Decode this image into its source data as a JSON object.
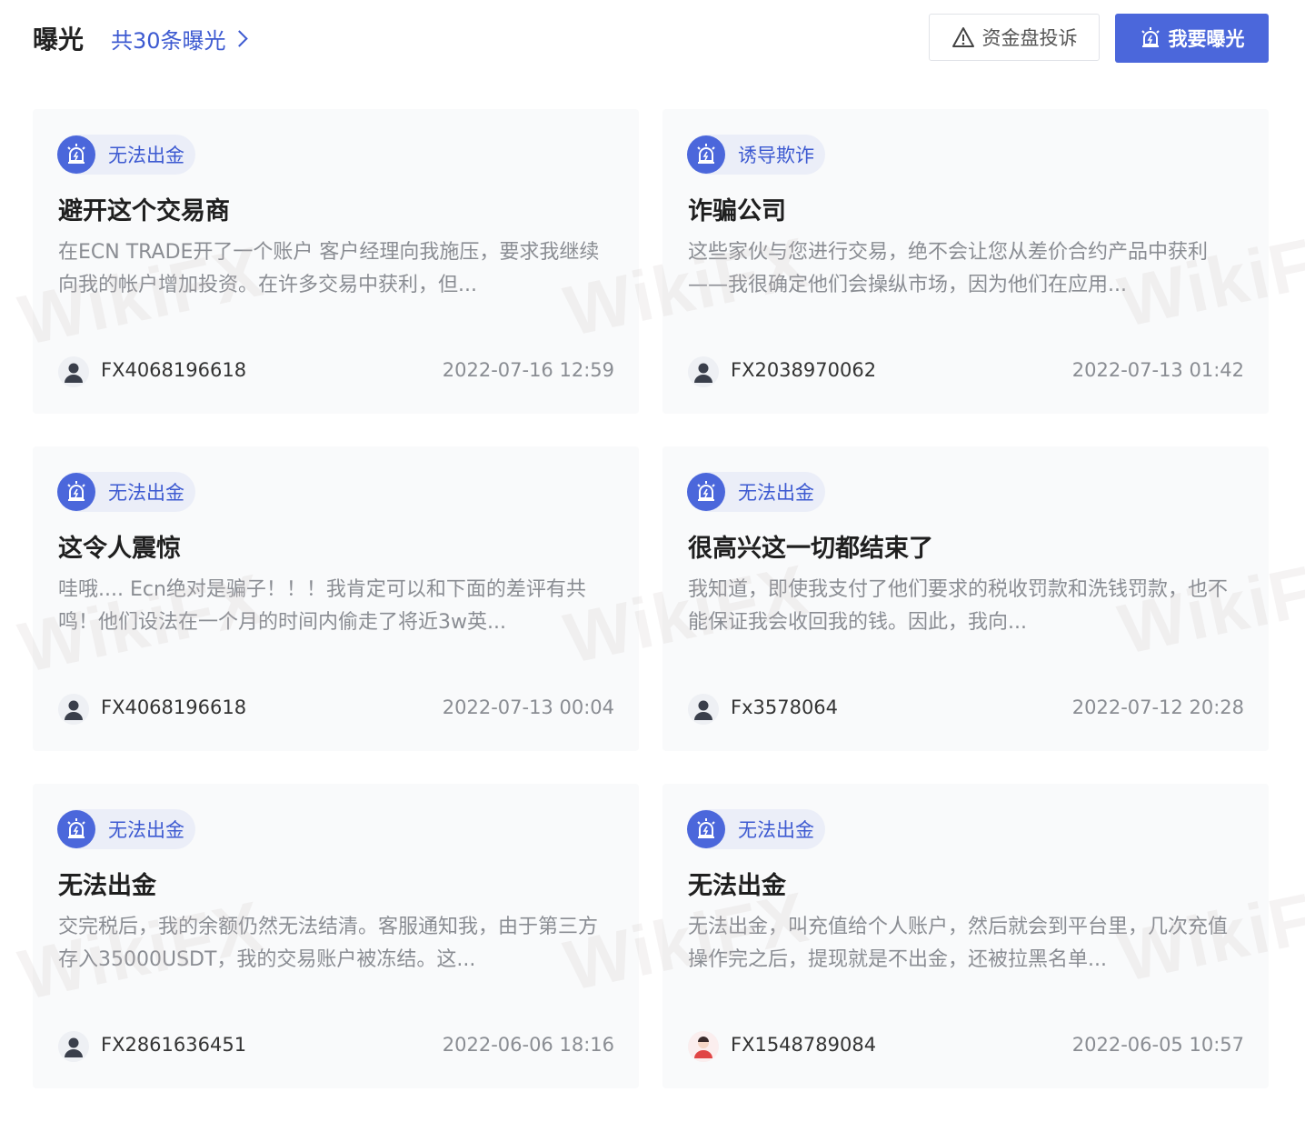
{
  "header": {
    "title": "曝光",
    "count_link": "共30条曝光",
    "complaint_button": "资金盘投诉",
    "expose_button": "我要曝光"
  },
  "watermark": "WikiFX",
  "cards": [
    {
      "tag": "无法出金",
      "title": "避开这个交易商",
      "desc": "在ECN TRADE开了一个账户 客户经理向我施压，要求我继续向我的帐户增加投资。在许多交易中获利，但...",
      "user": "FX4068196618",
      "date": "2022-07-16 12:59",
      "avatar": "default-avatar"
    },
    {
      "tag": "诱导欺诈",
      "title": "诈骗公司",
      "desc": "这些家伙与您进行交易，绝不会让您从差价合约产品中获利——我很确定他们会操纵市场，因为他们在应用...",
      "user": "FX2038970062",
      "date": "2022-07-13 01:42",
      "avatar": "default-avatar"
    },
    {
      "tag": "无法出金",
      "title": "这令人震惊",
      "desc": "哇哦.... Ecn绝对是骗子！！！我肯定可以和下面的差评有共鸣！他们设法在一个月的时间内偷走了将近3w英...",
      "user": "FX4068196618",
      "date": "2022-07-13 00:04",
      "avatar": "default-avatar"
    },
    {
      "tag": "无法出金",
      "title": "很高兴这一切都结束了",
      "desc": "我知道，即使我支付了他们要求的税收罚款和洗钱罚款，也不能保证我会收回我的钱。因此，我向...",
      "user": "Fx3578064",
      "date": "2022-07-12 20:28",
      "avatar": "default-avatar"
    },
    {
      "tag": "无法出金",
      "title": "无法出金",
      "desc": "交完税后，我的余额仍然无法结清。客服通知我，由于第三方存入35000USDT，我的交易账户被冻结。这...",
      "user": "FX2861636451",
      "date": "2022-06-06 18:16",
      "avatar": "default-avatar"
    },
    {
      "tag": "无法出金",
      "title": "无法出金",
      "desc": "无法出金，叫充值给个人账户，然后就会到平台里，几次充值操作完之后，提现就是不出金，还被拉黑名单...",
      "user": "FX1548789084",
      "date": "2022-06-05 10:57",
      "avatar": "red-avatar"
    }
  ],
  "colors": {
    "accent": "#4b67db",
    "link": "#3d5ad1",
    "card_bg": "#f9fafb",
    "muted_text": "#8a8d93"
  }
}
